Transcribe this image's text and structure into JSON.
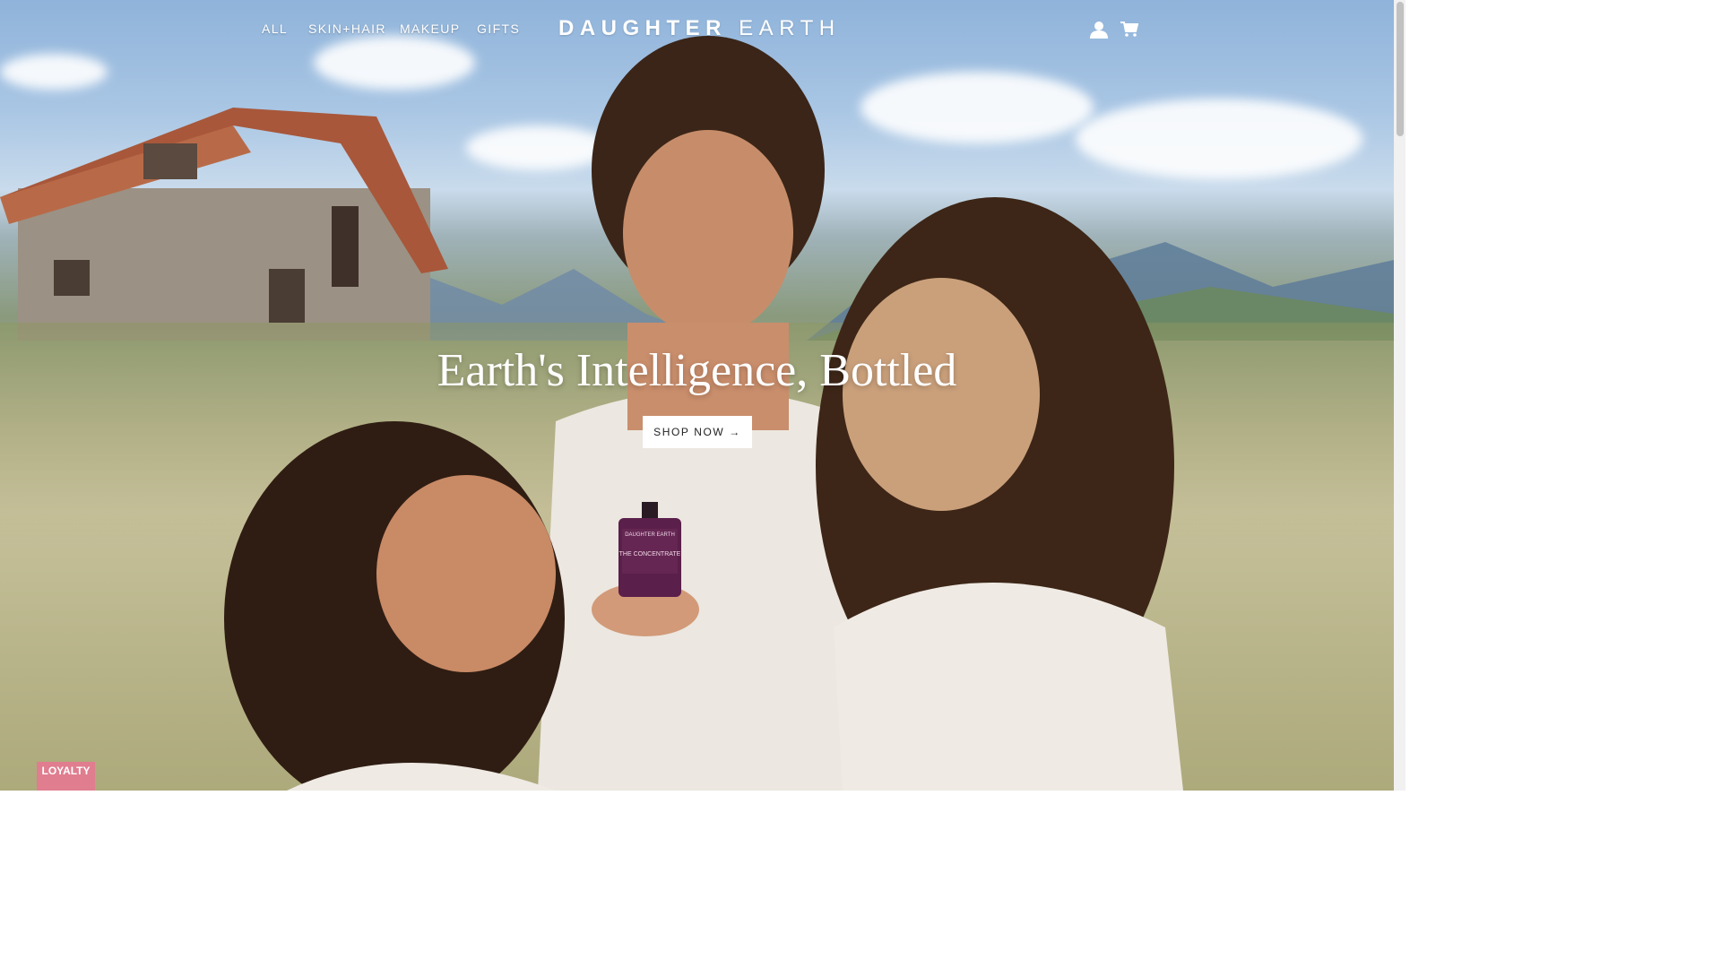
{
  "nav": {
    "links": [
      {
        "label": "ALL"
      },
      {
        "label": "SKIN+HAIR"
      },
      {
        "label": "MAKEUP"
      },
      {
        "label": "GIFTS"
      }
    ],
    "logo_bold": "DAUGHTER",
    "logo_light": "EARTH",
    "account_icon": "user-icon",
    "cart_icon": "cart-icon"
  },
  "hero": {
    "headline": "Earth's Intelligence, Bottled",
    "cta_label": "SHOP NOW →",
    "bottle_label_brand": "DAUGHTER EARTH",
    "bottle_label_product": "THE CONCENTRATE"
  },
  "loyalty": {
    "label": "LOYALTY"
  },
  "colors": {
    "nav_text": "#ffffff",
    "cta_background": "#ffffff",
    "loyalty_background": "#e07d8f",
    "bottle": "#5a1f4a"
  }
}
